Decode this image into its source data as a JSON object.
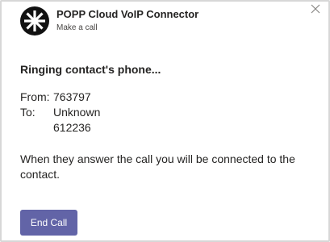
{
  "header": {
    "title": "POPP Cloud VoIP Connector",
    "subtitle": "Make a call",
    "logo_icon": "popp-logo-icon",
    "close_icon": "close-icon"
  },
  "body": {
    "heading": "Ringing contact's phone...",
    "facts": {
      "from_label": "From:",
      "from_value": "763797",
      "to_label": "To:",
      "to_value_line1": "Unknown",
      "to_value_line2": "612236"
    },
    "message": "When they answer the call you will be connected to the contact."
  },
  "actions": {
    "end_call_label": "End Call"
  },
  "colors": {
    "accent": "#6264a7",
    "text": "#252423",
    "border": "#d7d7d7"
  }
}
